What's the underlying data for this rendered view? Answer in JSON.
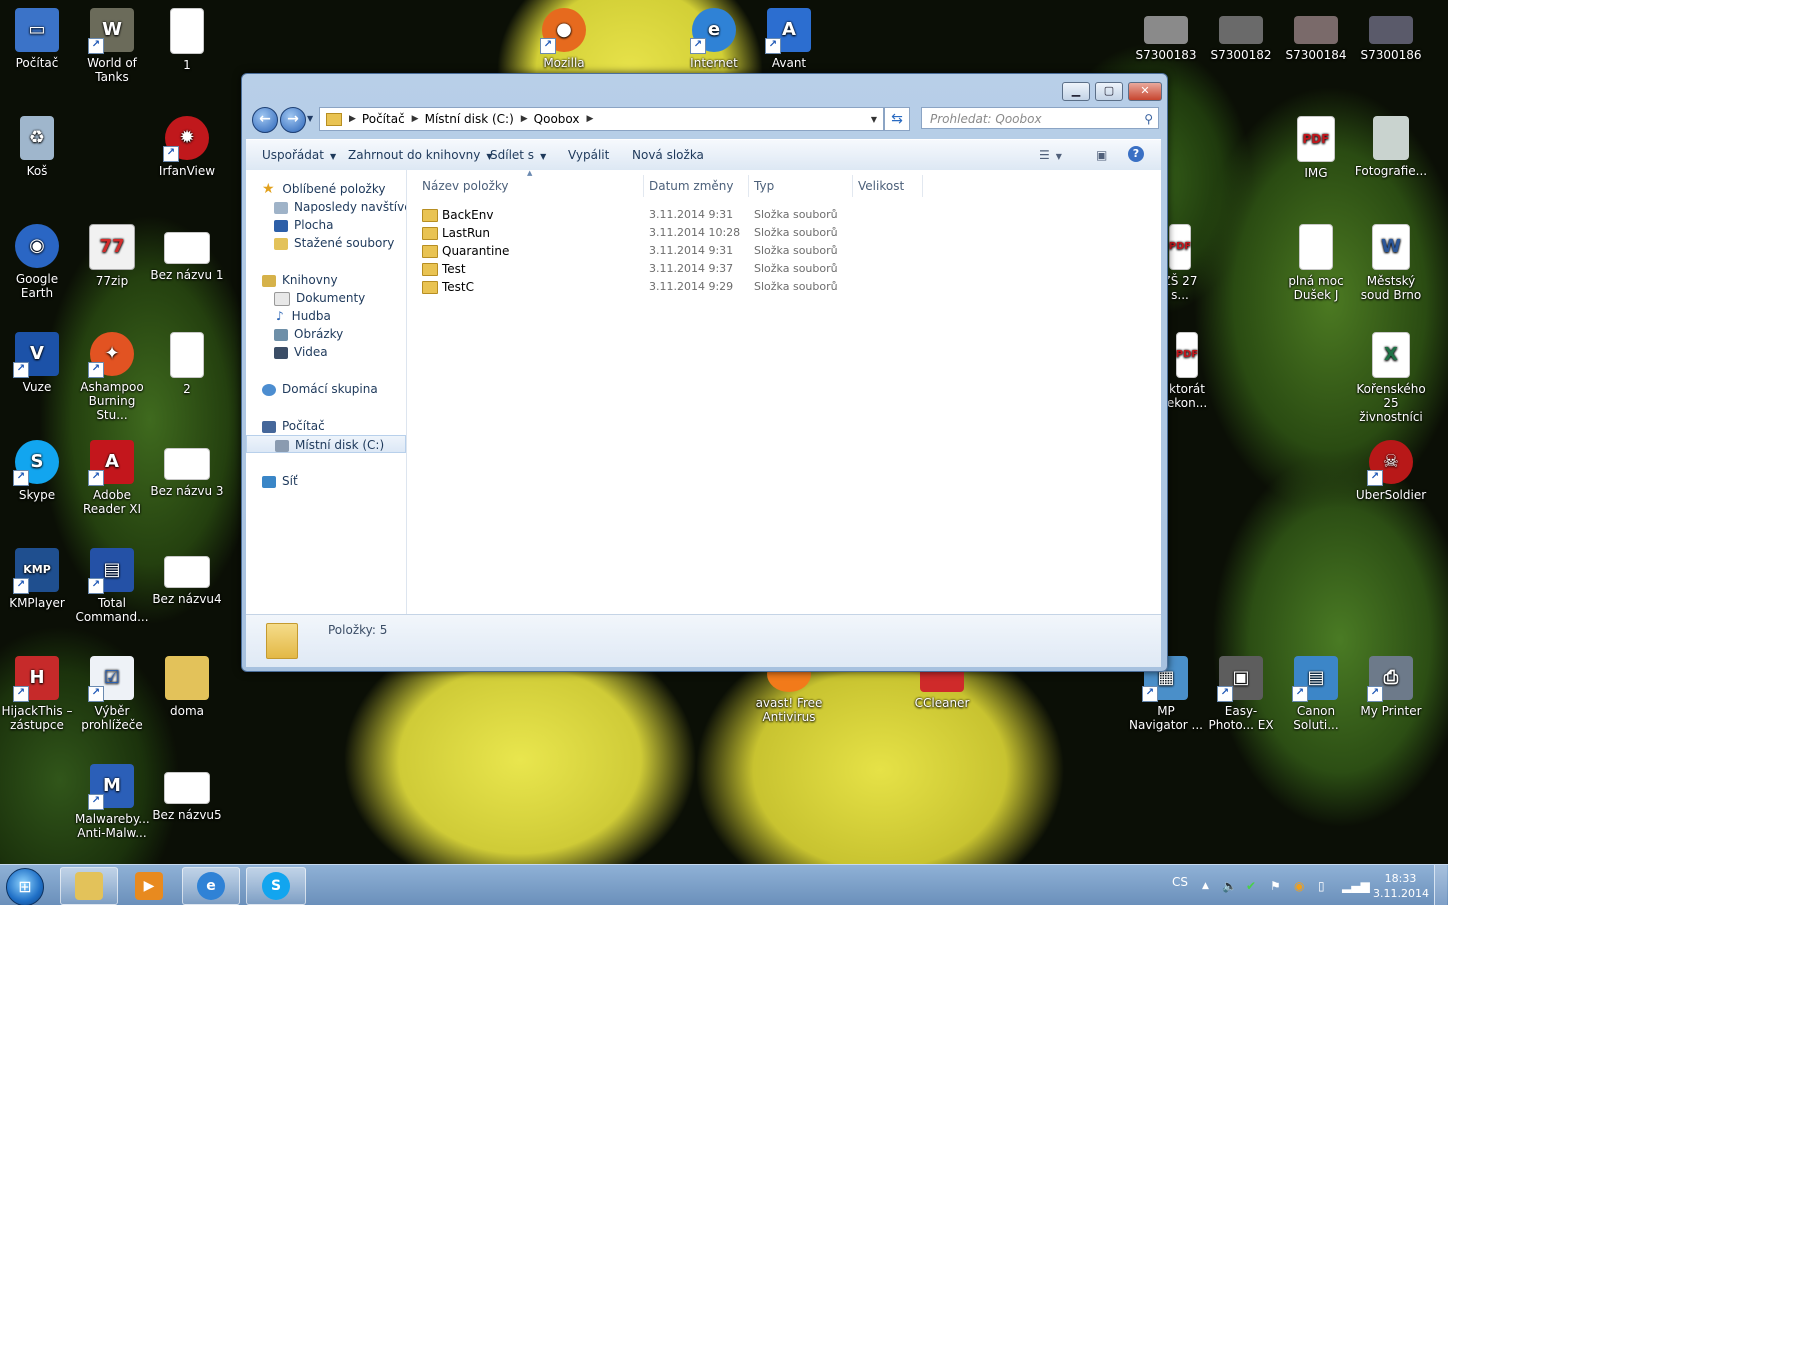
{
  "desktop": {
    "icons": [
      {
        "label": "Počítač",
        "icon": "computer-icon",
        "color": "#3b73c8"
      },
      {
        "label": "World of Tanks",
        "icon": "tank-icon",
        "color": "#6b6b5a"
      },
      {
        "label": "1",
        "icon": "document-icon",
        "color": "#ffffff"
      },
      {
        "label": "Koš",
        "icon": "recycle-bin-icon",
        "color": "#9fb6cc"
      },
      {
        "label": "IrfanView",
        "icon": "irfanview-icon",
        "color": "#c0181c"
      },
      {
        "label": "Google Earth",
        "icon": "google-earth-icon",
        "color": "#2a66c4"
      },
      {
        "label": "77zip",
        "icon": "calendar-77-icon",
        "color": "#d22c2c"
      },
      {
        "label": "Bez názvu 1",
        "icon": "image-icon",
        "color": "#ffffff"
      },
      {
        "label": "Vuze",
        "icon": "vuze-frog-icon",
        "color": "#1c52a8"
      },
      {
        "label": "Ashampoo Burning Stu...",
        "icon": "ashampoo-flame-icon",
        "color": "#e25322"
      },
      {
        "label": "2",
        "icon": "document-icon",
        "color": "#ffffff"
      },
      {
        "label": "Skype",
        "icon": "skype-icon",
        "color": "#12a5ef"
      },
      {
        "label": "Adobe Reader XI",
        "icon": "adobe-reader-icon",
        "color": "#c3161c"
      },
      {
        "label": "Bez názvu 3",
        "icon": "image-icon",
        "color": "#ffffff"
      },
      {
        "label": "KMPlayer",
        "icon": "kmplayer-icon",
        "color": "#1f4f8f"
      },
      {
        "label": "Total Command...",
        "icon": "floppy-disk-icon",
        "color": "#2451a6"
      },
      {
        "label": "Bez názvu4",
        "icon": "image-icon",
        "color": "#ffffff"
      },
      {
        "label": "HijackThis – zástupce",
        "icon": "hijackthis-icon",
        "color": "#c62a2a"
      },
      {
        "label": "Výběr prohlížeče",
        "icon": "checklist-icon",
        "color": "#eef2f7"
      },
      {
        "label": "doma",
        "icon": "user-folder-icon",
        "color": "#e3c25a"
      },
      {
        "label": "Malwareby... Anti-Malw...",
        "icon": "malwarebytes-icon",
        "color": "#2b5fb8"
      },
      {
        "label": "Bez názvu5",
        "icon": "image-icon",
        "color": "#ffffff"
      },
      {
        "label": "Mozilla",
        "icon": "firefox-icon",
        "color": "#e66a1e"
      },
      {
        "label": "Internet",
        "icon": "internet-explorer-icon",
        "color": "#2f82d6"
      },
      {
        "label": "Avant",
        "icon": "avant-browser-icon",
        "color": "#2c6ed0"
      },
      {
        "label": "S7300183",
        "icon": "photo-thumb-icon",
        "color": "#8a8a8a"
      },
      {
        "label": "S7300182",
        "icon": "photo-thumb-icon",
        "color": "#6a6a6a"
      },
      {
        "label": "S7300184",
        "icon": "photo-thumb-icon",
        "color": "#7a6a6a"
      },
      {
        "label": "S7300186",
        "icon": "photo-thumb-icon",
        "color": "#5a5a6a"
      },
      {
        "label": "IMG",
        "icon": "pdf-icon",
        "color": "#c3161c"
      },
      {
        "label": "Fotografie...",
        "icon": "photo-thumb-icon",
        "color": "#c9d3cf"
      },
      {
        "label": "ZŠ 27 s...",
        "icon": "pdf-icon",
        "color": "#c3161c"
      },
      {
        "label": "plná moc Dušek J",
        "icon": "document-icon",
        "color": "#ffffff"
      },
      {
        "label": "Městský soud Brno",
        "icon": "word-document-icon",
        "color": "#2b579a"
      },
      {
        "label": "ktorát ekon...",
        "icon": "pdf-icon",
        "color": "#c3161c"
      },
      {
        "label": "Kořenského 25 živnostníci",
        "icon": "excel-document-icon",
        "color": "#1e7145"
      },
      {
        "label": "UberSoldier",
        "icon": "ubersoldier-icon",
        "color": "#b81818"
      },
      {
        "label": "avast! Free Antivirus",
        "icon": "avast-icon",
        "color": "#f27a1a"
      },
      {
        "label": "CCleaner",
        "icon": "ccleaner-icon",
        "color": "#cf2a2a"
      },
      {
        "label": "MP Navigator ...",
        "icon": "scanner-icon",
        "color": "#4a8fc9"
      },
      {
        "label": "Easy-Photo... EX",
        "icon": "printer-photo-icon",
        "color": "#5d5d5d"
      },
      {
        "label": "Canon Soluti...",
        "icon": "canon-icon",
        "color": "#3c86c8"
      },
      {
        "label": "My Printer",
        "icon": "printer-icon",
        "color": "#6d7a8a"
      }
    ]
  },
  "explorer": {
    "nav_back": "back-arrow-icon",
    "nav_forward": "forward-arrow-icon",
    "address": {
      "crumbs": [
        "Počítač",
        "Místní disk (C:)",
        "Qoobox"
      ]
    },
    "search": {
      "placeholder": "Prohledat: Qoobox"
    },
    "toolbar": {
      "organize": "Uspořádat",
      "include_library": "Zahrnout do knihovny",
      "share": "Sdílet s",
      "burn": "Vypálit",
      "new_folder": "Nová složka"
    },
    "nav_pane": {
      "favorites": "Oblíbené položky",
      "recent": "Naposledy navštívené",
      "desktop": "Plocha",
      "downloads": "Stažené soubory",
      "libraries": "Knihovny",
      "documents": "Dokumenty",
      "music": "Hudba",
      "pictures": "Obrázky",
      "videos": "Videa",
      "homegroup": "Domácí skupina",
      "computer": "Počítač",
      "local_disk": "Místní disk (C:)",
      "network": "Síť"
    },
    "columns": {
      "name": "Název položky",
      "date": "Datum změny",
      "type": "Typ",
      "size": "Velikost"
    },
    "rows": [
      {
        "name": "BackEnv",
        "date": "3.11.2014 9:31",
        "type": "Složka souborů"
      },
      {
        "name": "LastRun",
        "date": "3.11.2014 10:28",
        "type": "Složka souborů"
      },
      {
        "name": "Quarantine",
        "date": "3.11.2014 9:31",
        "type": "Složka souborů"
      },
      {
        "name": "Test",
        "date": "3.11.2014 9:37",
        "type": "Složka souborů"
      },
      {
        "name": "TestC",
        "date": "3.11.2014 9:29",
        "type": "Složka souborů"
      }
    ],
    "status": "Položky: 5"
  },
  "taskbar": {
    "language": "CS",
    "time": "18:33",
    "date": "3.11.2014",
    "pinned": [
      "explorer-icon",
      "media-player-icon",
      "internet-explorer-icon",
      "skype-icon"
    ]
  }
}
